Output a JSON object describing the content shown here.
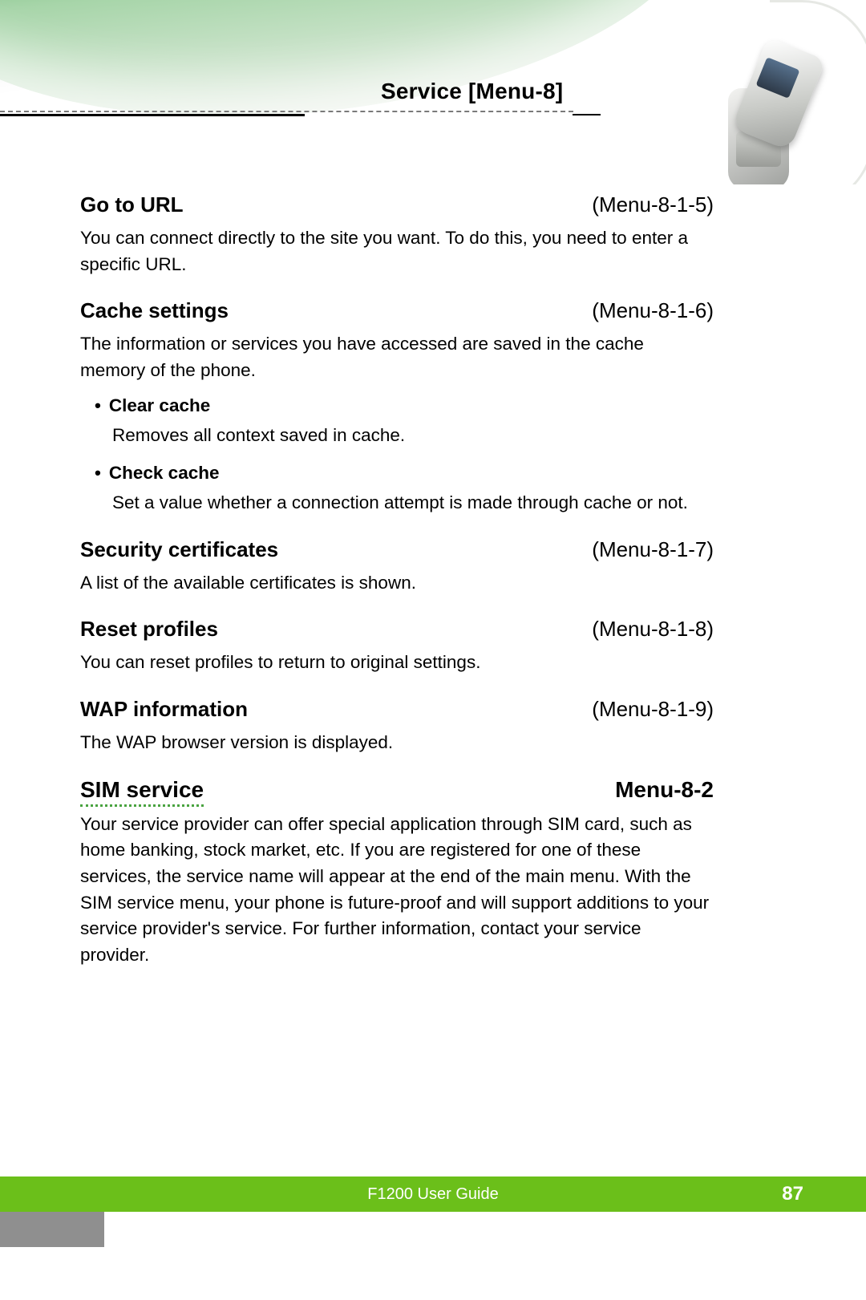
{
  "header": {
    "title": "Service [Menu-8]"
  },
  "sections": [
    {
      "title": "Go to URL",
      "menu": "(Menu-8-1-5)",
      "body": "You can connect directly to the site you want. To do this, you need to enter a specific URL."
    },
    {
      "title": "Cache settings",
      "menu": "(Menu-8-1-6)",
      "body": "The information or services you have accessed are saved in the cache memory of the phone.",
      "bullets": [
        {
          "title": "Clear cache",
          "body": "Removes all context saved in cache."
        },
        {
          "title": "Check cache",
          "body": "Set a value whether a connection attempt is made through cache or not."
        }
      ]
    },
    {
      "title": "Security certificates",
      "menu": "(Menu-8-1-7)",
      "body": "A list of the available certificates is shown."
    },
    {
      "title": "Reset profiles",
      "menu": "(Menu-8-1-8)",
      "body": "You can reset profiles to return to original settings."
    },
    {
      "title": "WAP information",
      "menu": "(Menu-8-1-9)",
      "body": "The WAP browser version is displayed."
    }
  ],
  "major": {
    "title": "SIM service",
    "menu": "Menu-8-2",
    "body": "Your service provider can offer special application through SIM card, such as home banking, stock market, etc. If you are registered for one of these services, the service name will appear at the end of the main menu. With the SIM service menu, your phone is future-proof and will support additions to your service provider's service. For further information, contact your service provider."
  },
  "footer": {
    "guide": "F1200 User Guide",
    "page": "87"
  }
}
